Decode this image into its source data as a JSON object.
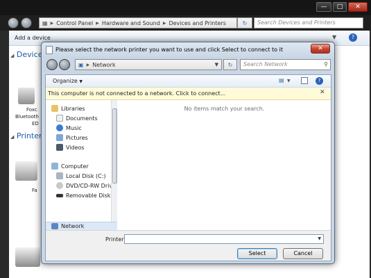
{
  "outer_window": {
    "breadcrumb": [
      "Control Panel",
      "Hardware and Sound",
      "Devices and Printers"
    ],
    "search_placeholder": "Search Devices and Printers",
    "toolbar_add_device": "Add a device",
    "section_devices": "Devices",
    "section_printers": "Printers",
    "device_label_1": "Foxc",
    "device_label_2": "Bluetooth",
    "device_label_3": "ED",
    "printer_label": "Fa"
  },
  "dialog": {
    "title": "Please select the network printer you want to use and click Select to connect to it",
    "address": "Network",
    "search_placeholder": "Search Network",
    "toolbar_organize": "Organize",
    "info_bar": "This computer is not connected to a network. Click to connect...",
    "empty_message": "No items match your search.",
    "tree": {
      "libraries": "Libraries",
      "documents": "Documents",
      "music": "Music",
      "pictures": "Pictures",
      "videos": "Videos",
      "computer": "Computer",
      "local_disk": "Local Disk (C:)",
      "dvd_drive": "DVD/CD-RW Drive",
      "removable_disk": "Removable Disk (",
      "network": "Network"
    },
    "printer_label": "Printer",
    "printer_value": "",
    "select_button": "Select",
    "cancel_button": "Cancel"
  }
}
